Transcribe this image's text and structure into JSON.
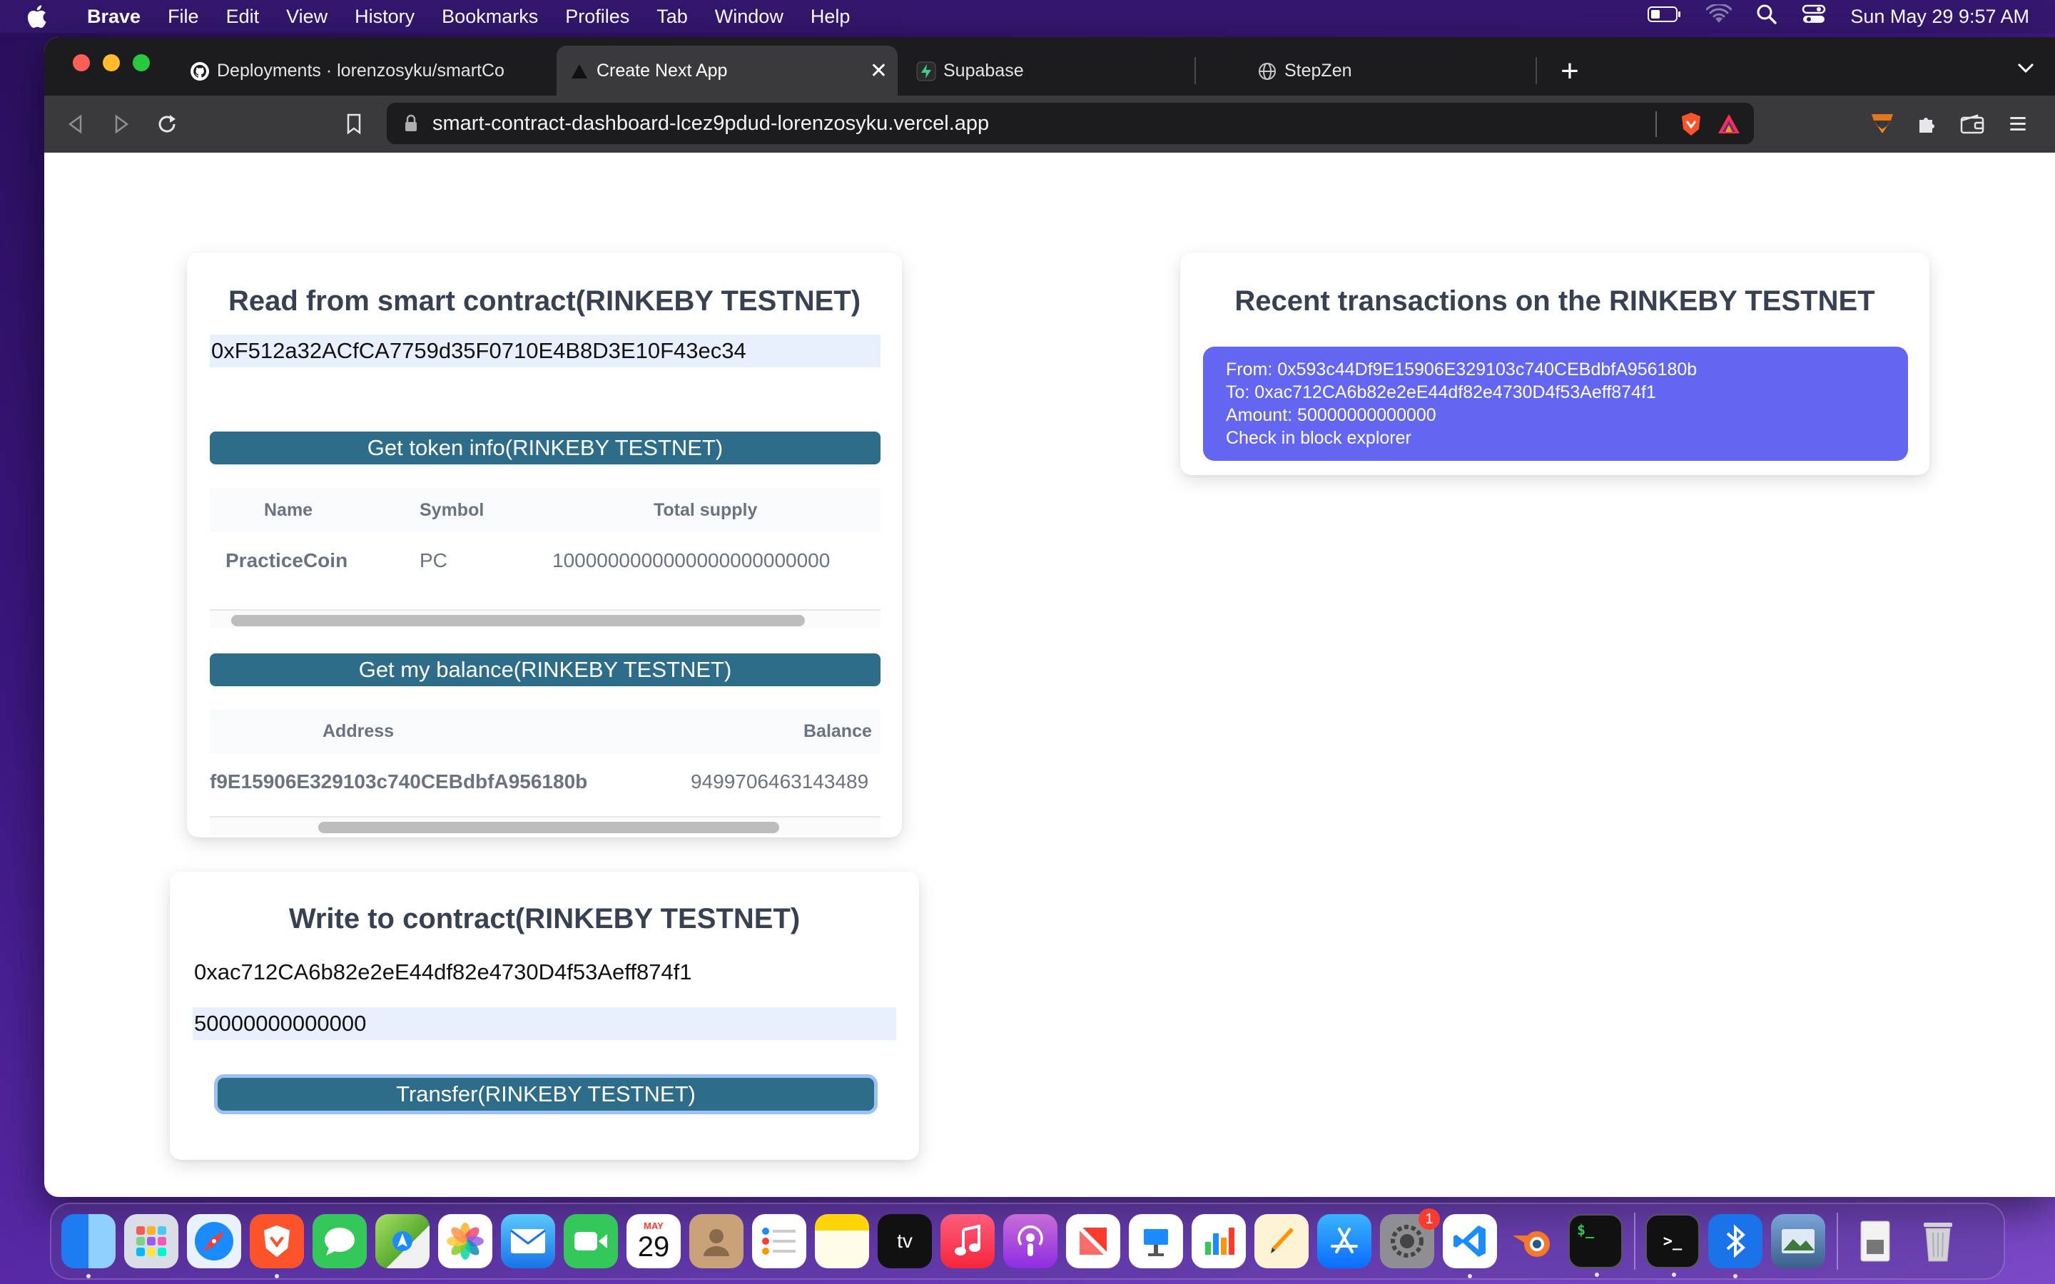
{
  "menubar": {
    "app_name": "Brave",
    "items": [
      "File",
      "Edit",
      "View",
      "History",
      "Bookmarks",
      "Profiles",
      "Tab",
      "Window",
      "Help"
    ],
    "clock": "Sun May 29  9:57 AM"
  },
  "browser": {
    "tabs": [
      {
        "title": "Deployments · lorenzosyku/smartCo",
        "icon": "github-icon"
      },
      {
        "title": "Create Next App",
        "icon": "nextjs-icon",
        "active": true
      },
      {
        "title": "Supabase",
        "icon": "supabase-icon"
      },
      {
        "title": "StepZen",
        "icon": "globe-icon"
      }
    ],
    "url": "smart-contract-dashboard-lcez9pdud-lorenzosyku.vercel.app"
  },
  "read_card": {
    "title": "Read from smart contract(RINKEBY TESTNET)",
    "contract_address": "0xF512a32ACfCA7759d35F0710E4B8D3E10F43ec34",
    "token_info_button": "Get token info(RINKEBY TESTNET)",
    "token_table": {
      "headers": [
        "Name",
        "Symbol",
        "Total supply"
      ],
      "row": [
        "PracticeCoin",
        "PC",
        "1000000000000000000000000"
      ]
    },
    "balance_button": "Get my balance(RINKEBY TESTNET)",
    "balance_table": {
      "headers": [
        "Address",
        "Balance"
      ],
      "row": [
        "f9E15906E329103c740CEBdbfA956180b",
        "9499706463143489"
      ]
    }
  },
  "write_card": {
    "title": "Write to contract(RINKEBY TESTNET)",
    "recipient": "0xac712CA6b82e2eE44df82e4730D4f53Aeff874f1",
    "amount": "50000000000000",
    "transfer_button": "Transfer(RINKEBY TESTNET)"
  },
  "tx_card": {
    "title": "Recent transactions on the RINKEBY TESTNET",
    "transactions": [
      {
        "from": "From: 0x593c44Df9E15906E329103c740CEBdbfA956180b",
        "to": "To: 0xac712CA6b82e2eE44df82e4730D4f53Aeff874f1",
        "amount": "Amount: 50000000000000",
        "link": "Check in block explorer"
      }
    ]
  },
  "dock": {
    "calendar_month": "MAY",
    "calendar_day": "29",
    "tv_label": "tv",
    "settings_badge": "1",
    "apps": [
      "finder",
      "launchpad",
      "safari",
      "brave",
      "messages",
      "maps",
      "photos",
      "mail",
      "facetime",
      "calendar",
      "contacts",
      "reminders",
      "notes",
      "tv",
      "music",
      "podcasts",
      "news",
      "keynote",
      "numbers",
      "pages",
      "app-store",
      "system-preferences",
      "vscode",
      "blender",
      "terminal",
      "iterm",
      "bluetooth",
      "preview",
      "downloads",
      "trash"
    ]
  },
  "colors": {
    "primary_button": "#2e6d8a",
    "tx_box": "#6366f1",
    "input_bg": "#e8f0fe"
  }
}
